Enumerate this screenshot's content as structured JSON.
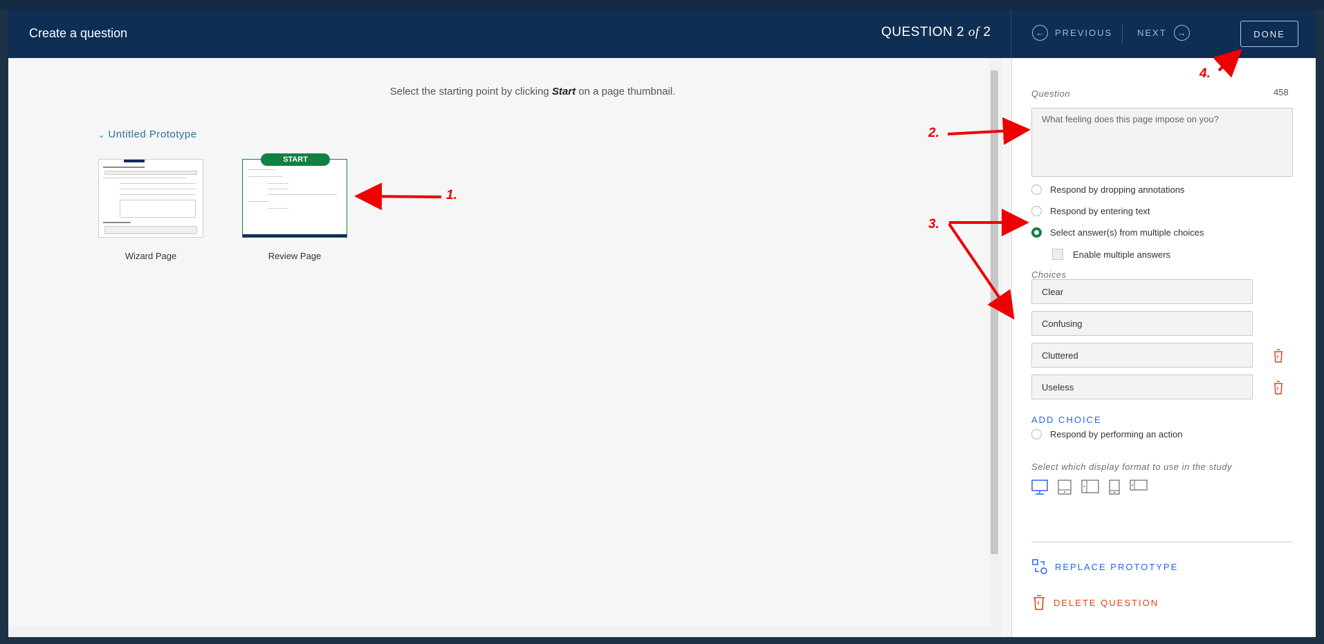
{
  "header": {
    "title": "Create a question",
    "question_prefix": "QUESTION 2",
    "question_of": "of",
    "question_total": "2",
    "previous_label": "PREVIOUS",
    "next_label": "NEXT",
    "done_label": "DONE"
  },
  "canvas": {
    "instruction_before": "Select the starting point by clicking",
    "instruction_bold": "Start",
    "instruction_after": "on a page thumbnail.",
    "prototype_name": "Untitled Prototype",
    "start_badge": "START",
    "pages": [
      {
        "name": "Wizard Page"
      },
      {
        "name": "Review Page"
      }
    ]
  },
  "panel": {
    "question_label": "Question",
    "char_count": "458",
    "question_placeholder": "What feeling does this page impose on you?",
    "options": [
      {
        "label": "Respond by dropping annotations",
        "selected": false
      },
      {
        "label": "Respond by entering text",
        "selected": false
      },
      {
        "label": "Select answer(s) from multiple choices",
        "selected": true
      },
      {
        "label": "Respond by performing an action",
        "selected": false
      }
    ],
    "enable_multiple_label": "Enable multiple answers",
    "choices_label": "Choices",
    "choices": [
      "Clear",
      "Confusing",
      "Cluttered",
      "Useless"
    ],
    "add_choice_label": "ADD CHOICE",
    "format_label": "Select which display format to use in the study",
    "formats": [
      "desktop-icon",
      "tablet-icon",
      "tablet-landscape-icon",
      "phone-icon",
      "phone-landscape-icon"
    ],
    "replace_label": "REPLACE PROTOTYPE",
    "delete_label": "DELETE QUESTION"
  },
  "annotations": [
    "1.",
    "2.",
    "3.",
    "4."
  ],
  "colors": {
    "header_bg": "#0e2e53",
    "accent_green": "#138043",
    "link_blue": "#2563eb",
    "danger": "#e0421b",
    "annotation_red": "#e00000"
  }
}
